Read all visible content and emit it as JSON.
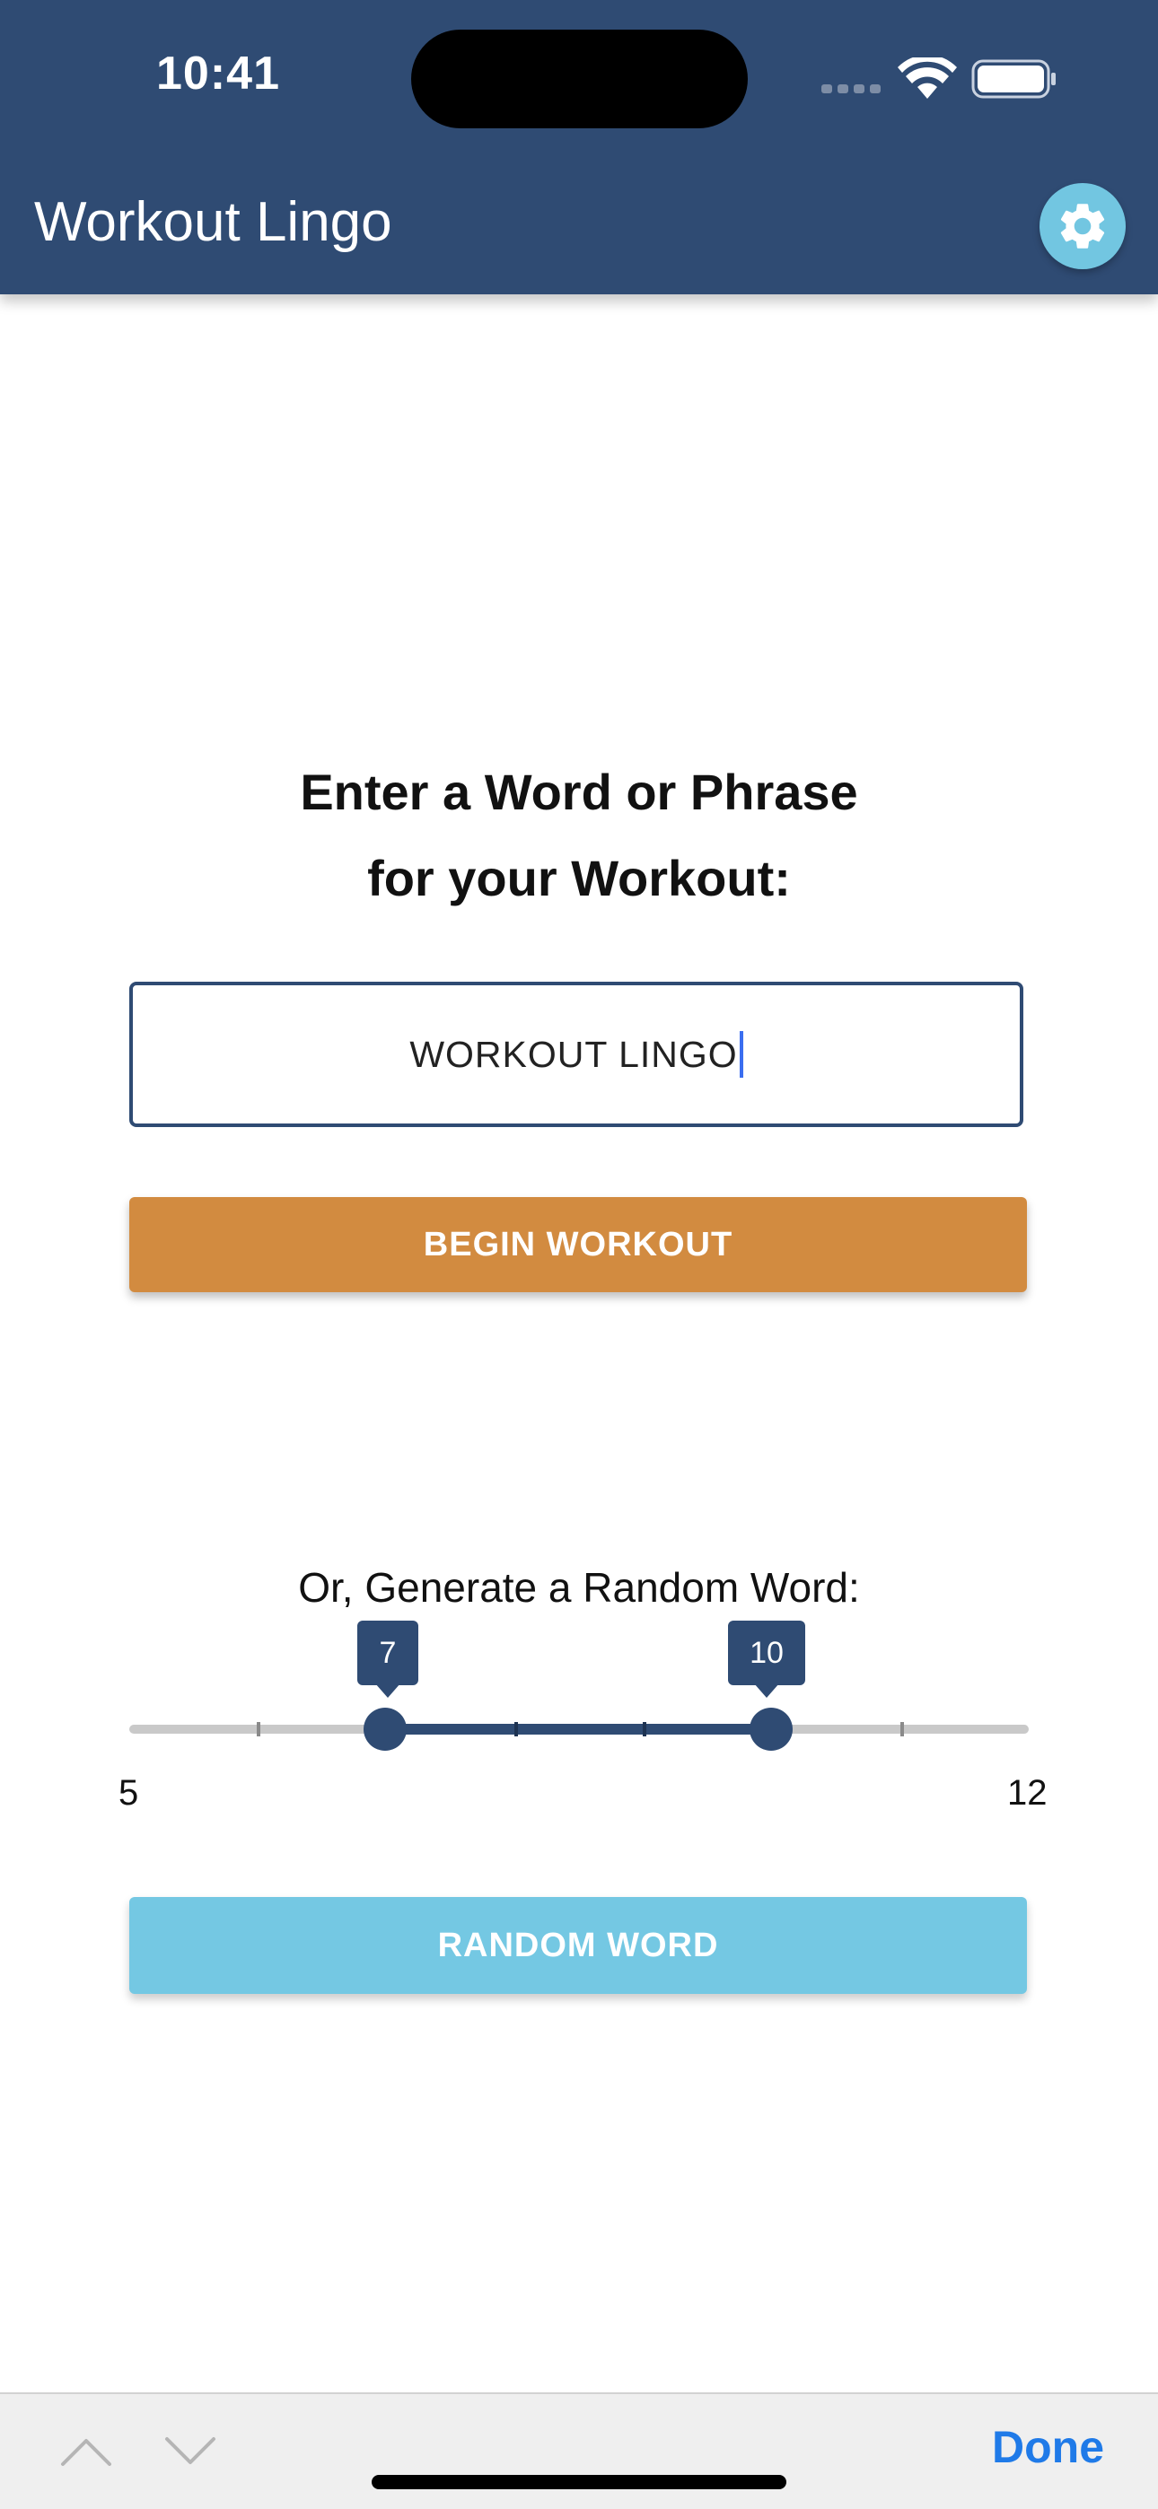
{
  "status_bar": {
    "time": "10:41"
  },
  "header": {
    "title": "Workout Lingo",
    "settings_icon": "gear-icon"
  },
  "main": {
    "prompt_line1": "Enter a Word or Phrase",
    "prompt_line2": "for your Workout:",
    "word_input_value": "WORKOUT LINGO",
    "begin_button_label": "BEGIN WORKOUT",
    "random_heading": "Or, Generate a Random Word:",
    "slider": {
      "min": "5",
      "max": "12",
      "lower_value": "7",
      "upper_value": "10"
    },
    "random_button_label": "RANDOM WORD"
  },
  "keyboard_accessory": {
    "prev_icon": "chevron-up-icon",
    "next_icon": "chevron-down-icon",
    "done_label": "Done"
  },
  "colors": {
    "primary": "#2f4b73",
    "begin_button": "#d28b40",
    "random_button": "#74c8e3",
    "done_link": "#1f7ae8"
  }
}
